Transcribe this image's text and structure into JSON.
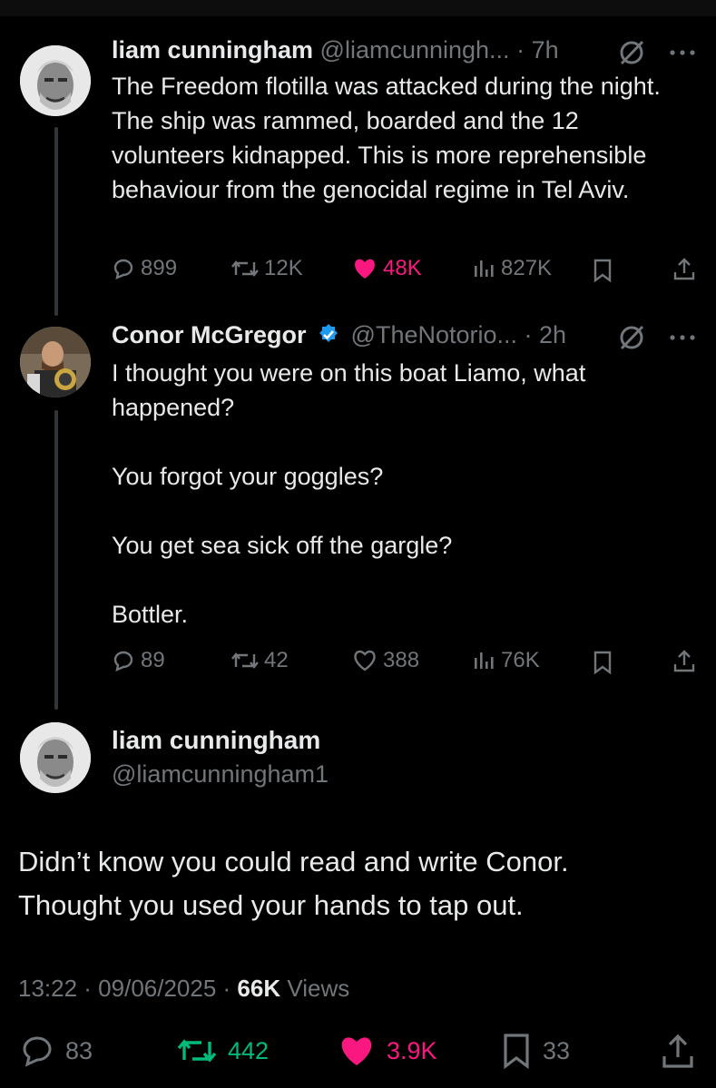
{
  "tweet1": {
    "name": "liam cunningham",
    "handle": "@liamcunningh...",
    "time": "· 7h",
    "text": "The Freedom flotilla was attacked during the night. The ship was rammed, boarded and the 12 volunteers kidnapped. This is more reprehensible behaviour from the genocidal regime in Tel Aviv.",
    "replies": "899",
    "reposts": "12K",
    "likes": "48K",
    "views": "827K"
  },
  "tweet2": {
    "name": "Conor McGregor",
    "handle": "@TheNotorio...",
    "time": "· 2h",
    "text": "I thought you were on this boat Liamo, what happened?\n\nYou forgot your goggles?\n\nYou get sea sick off the gargle?\n\nBottler.",
    "replies": "89",
    "reposts": "42",
    "likes": "388",
    "views": "76K"
  },
  "main": {
    "name": "liam cunningham",
    "handle": "@liamcunningham1",
    "text": "Didn’t know you could read and write Conor.\nThought you used your hands to tap out.",
    "timestamp": "13:22 · 09/06/2025 ·",
    "views_count": "66K",
    "views_label": "Views",
    "replies": "83",
    "reposts": "442",
    "likes": "3.9K",
    "bookmarks": "33"
  },
  "colors": {
    "background": "#000000",
    "text": "#e7e9ea",
    "muted": "#71767b",
    "like": "#f91880",
    "repost": "#00ba7c",
    "verified": "#1d9bf0"
  },
  "icons": [
    "reply-icon",
    "repost-icon",
    "like-icon",
    "views-icon",
    "bookmark-icon",
    "share-icon",
    "grok-icon",
    "more-icon",
    "verified-badge-icon"
  ]
}
